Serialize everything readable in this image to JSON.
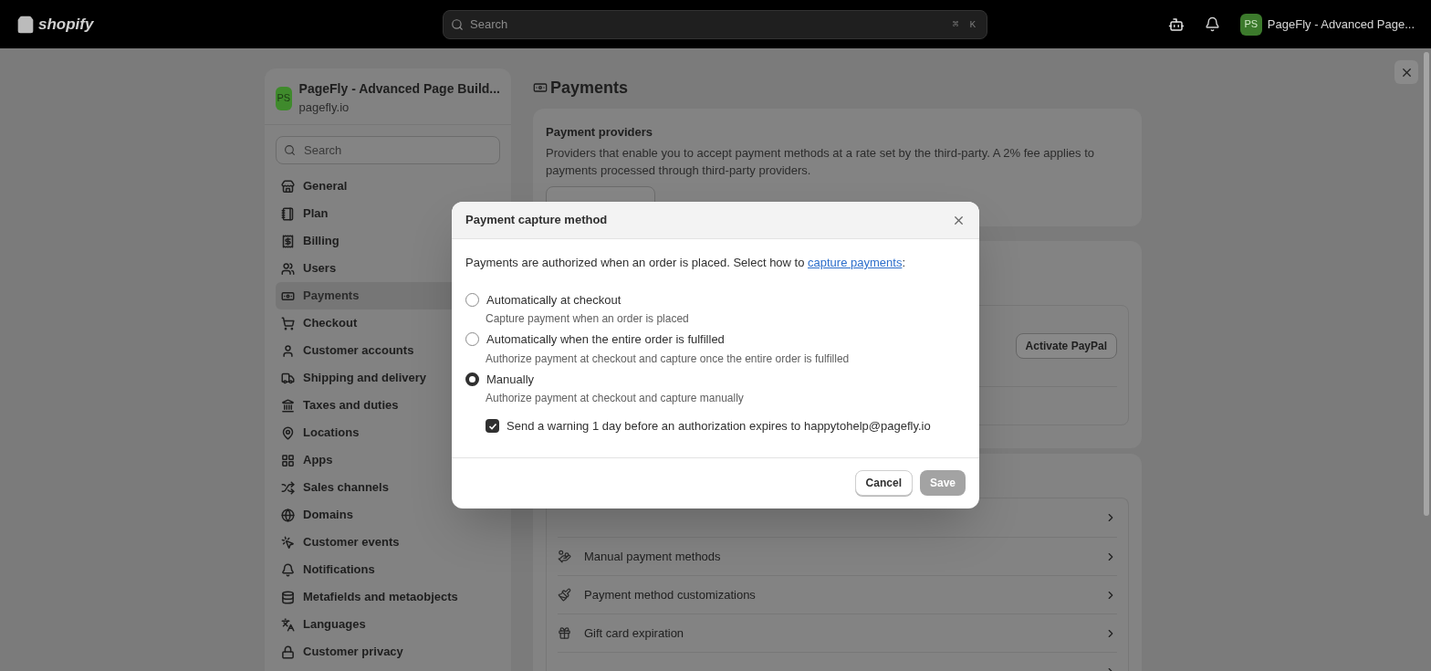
{
  "top_bar": {
    "logo": "shopify",
    "search": {
      "placeholder": "Search",
      "shortcut": [
        "⌘",
        "K"
      ]
    },
    "store": {
      "initials": "PS",
      "name": "PageFly - Advanced Page..."
    }
  },
  "sidebar": {
    "store": {
      "initials": "PS",
      "name": "PageFly - Advanced Page Build...",
      "domain": "pagefly.io"
    },
    "search": {
      "placeholder": "Search"
    },
    "items": [
      {
        "label": "General",
        "selected": false
      },
      {
        "label": "Plan",
        "selected": false
      },
      {
        "label": "Billing",
        "selected": false
      },
      {
        "label": "Users",
        "selected": false
      },
      {
        "label": "Payments",
        "selected": true
      },
      {
        "label": "Checkout",
        "selected": false
      },
      {
        "label": "Customer accounts",
        "selected": false
      },
      {
        "label": "Shipping and delivery",
        "selected": false
      },
      {
        "label": "Taxes and duties",
        "selected": false
      },
      {
        "label": "Locations",
        "selected": false
      },
      {
        "label": "Apps",
        "selected": false
      },
      {
        "label": "Sales channels",
        "selected": false
      },
      {
        "label": "Domains",
        "selected": false
      },
      {
        "label": "Customer events",
        "selected": false
      },
      {
        "label": "Notifications",
        "selected": false
      },
      {
        "label": "Metafields and metaobjects",
        "selected": false
      },
      {
        "label": "Languages",
        "selected": false
      },
      {
        "label": "Customer privacy",
        "selected": false
      }
    ]
  },
  "page": {
    "title": "Payments",
    "providers_card": {
      "title": "Payment providers",
      "description": "Providers that enable you to accept payment methods at a rate set by the third-party. A 2% fee applies to payments processed through third-party providers."
    },
    "paypal_card": {
      "button": "Activate PayPal"
    },
    "settings_list": [
      {
        "label": "Manual payment methods"
      },
      {
        "label": "Payment method customizations"
      },
      {
        "label": "Gift card expiration"
      }
    ]
  },
  "modal": {
    "title": "Payment capture method",
    "intro": "Payments are authorized when an order is placed. Select how to ",
    "link": "capture payments",
    "intro_end": ":",
    "options": [
      {
        "label": "Automatically at checkout",
        "description": "Capture payment when an order is placed",
        "selected": false
      },
      {
        "label": "Automatically when the entire order is fulfilled",
        "description": "Authorize payment at checkout and capture once the entire order is fulfilled",
        "selected": false
      },
      {
        "label": "Manually",
        "description": "Authorize payment at checkout and capture manually",
        "selected": true
      }
    ],
    "warning": {
      "label": "Send a warning 1 day before an authorization expires to happytohelp@pagefly.io",
      "checked": true
    },
    "buttons": [
      {
        "label": "Cancel",
        "disabled": false
      },
      {
        "label": "Save",
        "disabled": true
      }
    ]
  }
}
